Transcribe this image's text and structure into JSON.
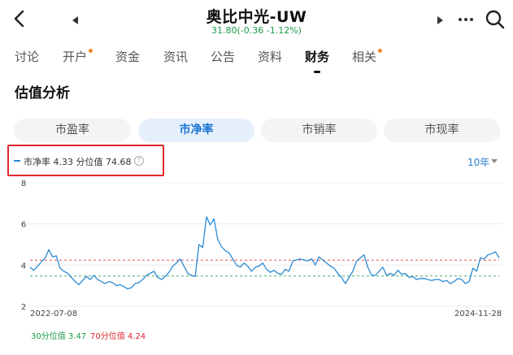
{
  "header": {
    "title": "奥比中光-UW",
    "quote": "31.80(-0.36 -1.12%)"
  },
  "tabs": [
    {
      "label": "讨论",
      "dot": false,
      "active": false
    },
    {
      "label": "开户",
      "dot": true,
      "active": false
    },
    {
      "label": "资金",
      "dot": false,
      "active": false
    },
    {
      "label": "资讯",
      "dot": false,
      "active": false
    },
    {
      "label": "公告",
      "dot": false,
      "active": false
    },
    {
      "label": "资料",
      "dot": false,
      "active": false
    },
    {
      "label": "财务",
      "dot": false,
      "active": true
    },
    {
      "label": "相关",
      "dot": true,
      "active": false
    }
  ],
  "section_title": "估值分析",
  "segments": [
    {
      "label": "市盈率",
      "active": false
    },
    {
      "label": "市净率",
      "active": true
    },
    {
      "label": "市销率",
      "active": false
    },
    {
      "label": "市现率",
      "active": false
    }
  ],
  "legend": {
    "text": "市净率 4.33  分位值 74.68",
    "help": "?"
  },
  "range_select": "10年",
  "colors": {
    "accent": "#2a8ad4",
    "positive": "#1a9a4b",
    "negative": "#e0262c",
    "tab_dot": "#f08a24"
  },
  "chart_data": {
    "type": "line",
    "x_start": "2022-07-08",
    "x_end": "2024-11-28",
    "ylim": [
      2,
      8
    ],
    "yticks": [
      "2",
      "4",
      "6",
      "8"
    ],
    "grid": true,
    "series": [
      {
        "name": "市净率",
        "values": [
          3.9,
          3.75,
          3.95,
          4.15,
          4.35,
          4.75,
          4.4,
          4.45,
          3.85,
          3.7,
          3.6,
          3.4,
          3.2,
          3.05,
          3.25,
          3.45,
          3.3,
          3.5,
          3.3,
          3.2,
          3.1,
          3.2,
          3.15,
          3.0,
          3.05,
          2.95,
          2.85,
          2.9,
          3.1,
          3.15,
          3.3,
          3.5,
          3.6,
          3.7,
          3.4,
          3.3,
          3.45,
          3.65,
          3.95,
          4.1,
          4.3,
          3.95,
          3.6,
          3.5,
          3.45,
          5.0,
          4.85,
          6.35,
          5.95,
          6.25,
          5.25,
          4.9,
          4.7,
          4.6,
          4.3,
          4.0,
          3.9,
          4.1,
          3.95,
          3.7,
          3.9,
          3.95,
          4.1,
          3.8,
          3.65,
          3.75,
          3.6,
          3.55,
          3.8,
          3.7,
          4.2,
          4.25,
          4.3,
          4.25,
          4.2,
          4.3,
          4.0,
          4.4,
          4.25,
          4.1,
          3.95,
          3.85,
          3.6,
          3.4,
          3.1,
          3.4,
          3.7,
          4.2,
          4.35,
          4.5,
          3.9,
          3.5,
          3.5,
          3.7,
          3.9,
          3.5,
          3.6,
          3.5,
          3.75,
          3.55,
          3.6,
          3.4,
          3.45,
          3.3,
          3.35,
          3.35,
          3.3,
          3.25,
          3.3,
          3.3,
          3.2,
          3.25,
          3.1,
          3.2,
          3.35,
          3.3,
          3.1,
          3.2,
          3.85,
          3.7,
          4.35,
          4.3,
          4.5,
          4.55,
          4.65,
          4.35
        ]
      }
    ],
    "reference_lines": [
      {
        "name": "30分位值",
        "value": 3.47,
        "color": "#1a9a4b",
        "label": "30分位值 3.47"
      },
      {
        "name": "70分位值",
        "value": 4.24,
        "color": "#e0262c",
        "label": "70分位值 4.24"
      }
    ]
  }
}
